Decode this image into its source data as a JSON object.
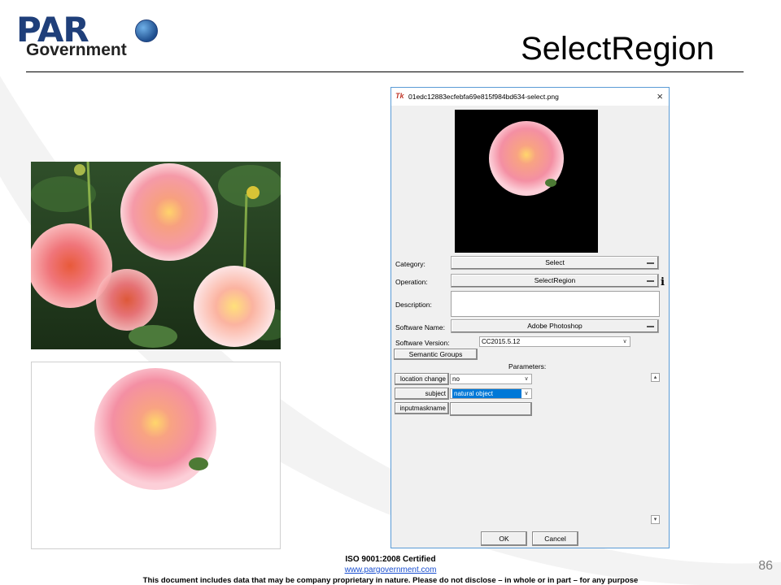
{
  "header": {
    "logo_text": "PAR",
    "logo_sub": "Government",
    "title": "SelectRegion"
  },
  "dialog": {
    "tk_icon": "Tk",
    "window_title": "01edc12883ecfebfa69e815f984bd634-select.png",
    "close_icon": "×",
    "category_label": "Category:",
    "category_value": "Select",
    "operation_label": "Operation:",
    "operation_value": "SelectRegion",
    "info_icon": "i",
    "description_label": "Description:",
    "software_name_label": "Software Name:",
    "software_name_value": "Adobe Photoshop",
    "software_version_label": "Software Version:",
    "software_version_value": "CC2015.5.12",
    "semantic_groups_button": "Semantic Groups",
    "parameters_label": "Parameters:",
    "parameters": [
      {
        "name": "location change",
        "value": "no",
        "has_dropdown": true,
        "highlighted": false
      },
      {
        "name": "subject",
        "value": "natural object",
        "has_dropdown": true,
        "highlighted": true
      },
      {
        "name": "inputmaskname",
        "value": "",
        "has_dropdown": false,
        "highlighted": false
      }
    ],
    "ok_button": "OK",
    "cancel_button": "Cancel"
  },
  "footer": {
    "cert": "ISO 9001:2008 Certified",
    "url": "www.pargovernment.com",
    "disclaimer": "This document includes data that may be company proprietary in nature. Please do not disclose – in whole or in part – for any purpose",
    "page_number": "86"
  },
  "colors": {
    "brand": "#1f3f7a",
    "dialog_border": "#5a9bd5",
    "selection": "#0078d7"
  }
}
